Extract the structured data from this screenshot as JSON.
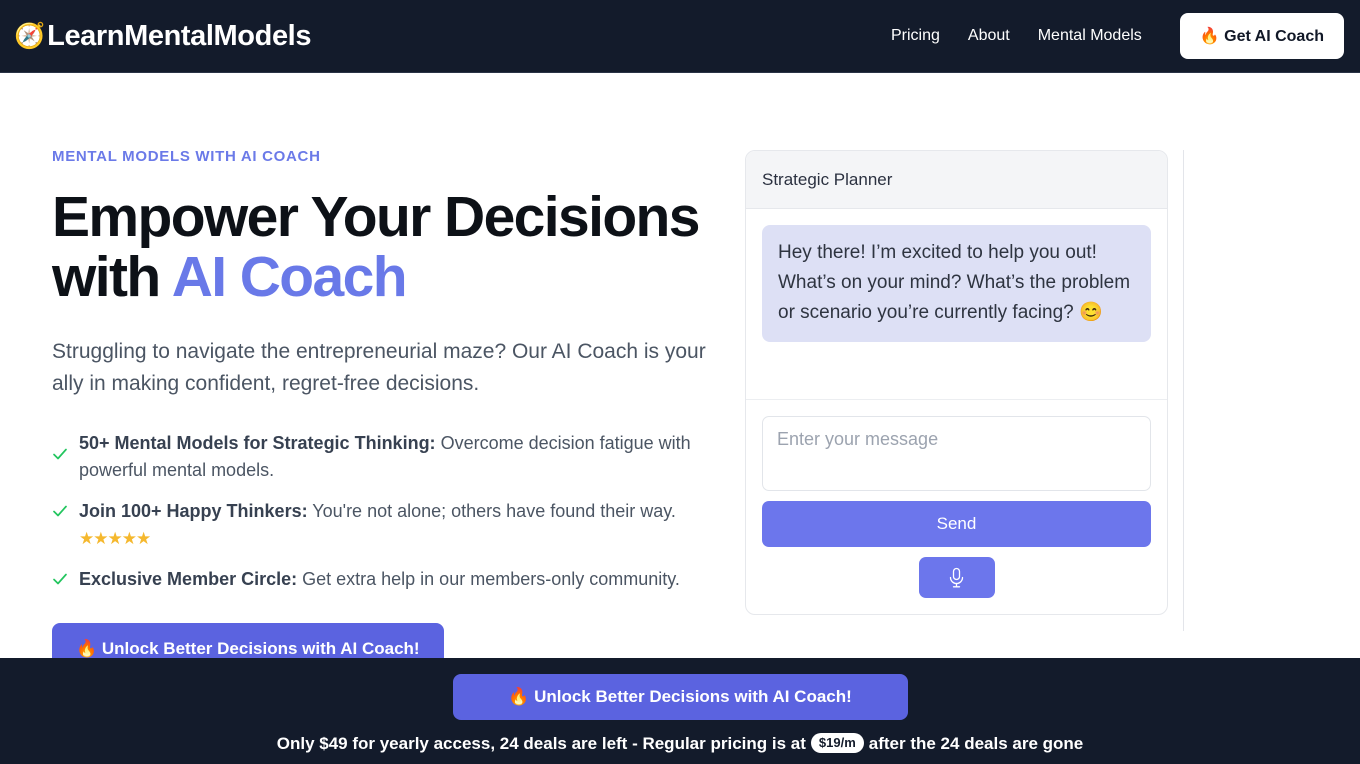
{
  "header": {
    "logo_icon": "compass-icon",
    "logo_emoji": "🧭",
    "brand": "LearnMentalModels",
    "nav": [
      {
        "label": "Pricing"
      },
      {
        "label": "About"
      },
      {
        "label": "Mental Models"
      }
    ],
    "cta": "🔥 Get AI Coach"
  },
  "hero": {
    "eyebrow": "MENTAL MODELS WITH AI COACH",
    "headline_line1": "Empower Your Decisions",
    "headline_with": "with ",
    "headline_accent": "AI Coach",
    "subtitle": "Struggling to navigate the entrepreneurial maze? Our AI Coach is your ally in making confident, regret-free decisions.",
    "features": [
      {
        "bold": "50+ Mental Models for Strategic Thinking:",
        "rest": " Overcome decision fatigue with powerful mental models.",
        "stars": ""
      },
      {
        "bold": "Join 100+ Happy Thinkers:",
        "rest": " You're not alone; others have found their way. ",
        "stars": "★★★★★"
      },
      {
        "bold": "Exclusive Member Circle:",
        "rest": " Get extra help in our members-only community.",
        "stars": ""
      }
    ],
    "cta": "🔥 Unlock Better Decisions with AI Coach!"
  },
  "chat": {
    "title": "Strategic Planner",
    "message": "Hey there! I’m excited to help you out! What’s on your mind? What’s the problem or scenario you’re currently facing? 😊",
    "input_value": "",
    "input_placeholder": "Enter your message",
    "send_label": "Send",
    "mic_icon": "microphone-icon"
  },
  "bottom_bar": {
    "cta": "🔥 Unlock Better Decisions with AI Coach!",
    "note_before": "Only $49 for yearly access, 24 deals are left - Regular pricing is at",
    "price_pill": "$19/m",
    "note_after": "after the 24 deals are gone"
  },
  "colors": {
    "header_bg": "#131b2b",
    "accent_blue": "#6979e8",
    "cta_blue": "#5b63e0",
    "send_blue": "#6c76ec",
    "bubble_bg": "#dde0f5",
    "check_green": "#22c55e",
    "star_gold": "#f5b82e"
  }
}
